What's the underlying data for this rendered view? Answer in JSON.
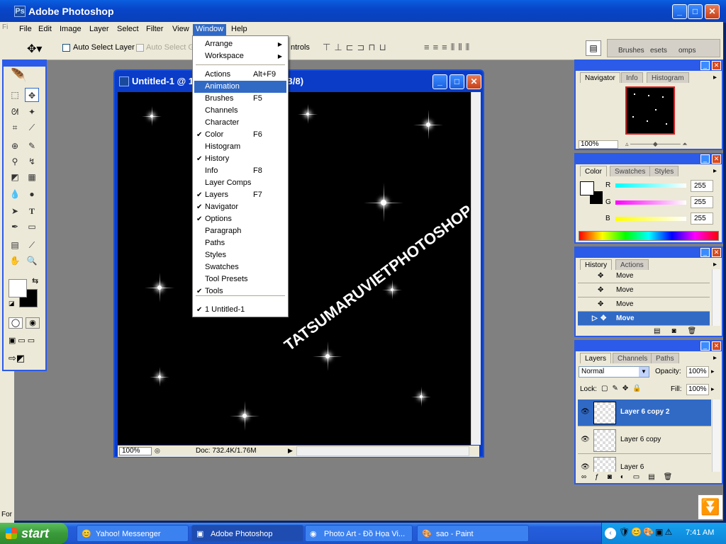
{
  "window": {
    "title": "Adobe Photoshop"
  },
  "menubar": [
    "File",
    "Edit",
    "Image",
    "Layer",
    "Select",
    "Filter",
    "View",
    "Window",
    "Help"
  ],
  "options": {
    "auto_select_layer": "Auto Select Layer",
    "auto_select_groups": "Auto Select Gr",
    "show_controls": "ntrols"
  },
  "palette_well": [
    "Brushes",
    "esets",
    "omps"
  ],
  "window_menu": {
    "items": [
      {
        "label": "Arrange",
        "submenu": true
      },
      {
        "label": "Workspace",
        "submenu": true
      },
      {
        "label": "Actions",
        "shortcut": "Alt+F9"
      },
      {
        "label": "Animation",
        "selected": true
      },
      {
        "label": "Brushes",
        "shortcut": "F5"
      },
      {
        "label": "Channels"
      },
      {
        "label": "Character"
      },
      {
        "label": "Color",
        "shortcut": "F6",
        "checked": true
      },
      {
        "label": "Histogram"
      },
      {
        "label": "History",
        "checked": true
      },
      {
        "label": "Info",
        "shortcut": "F8"
      },
      {
        "label": "Layer Comps"
      },
      {
        "label": "Layers",
        "shortcut": "F7",
        "checked": true
      },
      {
        "label": "Navigator",
        "checked": true
      },
      {
        "label": "Options",
        "checked": true
      },
      {
        "label": "Paragraph"
      },
      {
        "label": "Paths"
      },
      {
        "label": "Styles"
      },
      {
        "label": "Swatches"
      },
      {
        "label": "Tool Presets"
      },
      {
        "label": "Tools",
        "checked": true
      },
      {
        "label": "1 Untitled-1",
        "checked": true
      }
    ]
  },
  "document": {
    "title_left": "Untitled-1 @ 1",
    "title_right": "RGB/8)",
    "zoom": "100%",
    "doc_info": "Doc: 732.4K/1.76M",
    "watermark": "TATSUMARUVIETPHOTOSHOP"
  },
  "navigator": {
    "tabs": [
      "Navigator",
      "Info",
      "Histogram"
    ],
    "zoom": "100%"
  },
  "color": {
    "tabs": [
      "Color",
      "Swatches",
      "Styles"
    ],
    "r": "255",
    "g": "255",
    "b": "255",
    "r_label": "R",
    "g_label": "G",
    "b_label": "B"
  },
  "history": {
    "tabs": [
      "History",
      "Actions"
    ],
    "items": [
      "Move",
      "Move",
      "Move",
      "Move"
    ]
  },
  "layers": {
    "tabs": [
      "Layers",
      "Channels",
      "Paths"
    ],
    "blend_mode": "Normal",
    "opacity_label": "Opacity:",
    "opacity": "100%",
    "lock_label": "Lock:",
    "fill_label": "Fill:",
    "fill": "100%",
    "items": [
      "Layer 6 copy 2",
      "Layer 6 copy",
      "Layer 6"
    ]
  },
  "taskbar": {
    "start": "start",
    "tasks": [
      "Yahoo! Messenger",
      "Adobe Photoshop",
      "Photo Art - Đồ Họa Vi...",
      "sao - Paint"
    ],
    "clock": "7:41 AM"
  },
  "left_edge": {
    "fi": "Fi",
    "for": "For"
  }
}
